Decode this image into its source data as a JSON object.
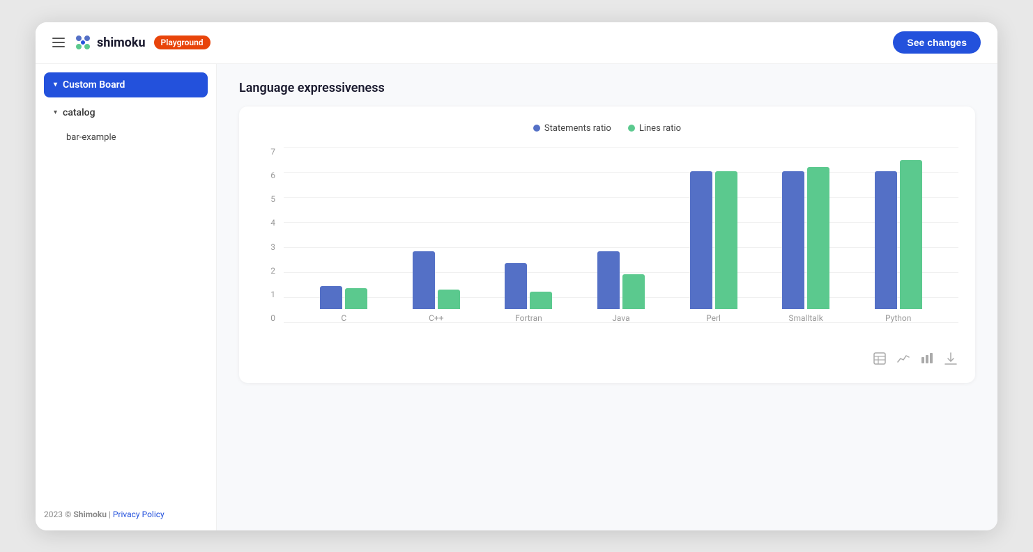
{
  "header": {
    "hamburger_label": "menu",
    "logo_text": "shimoku",
    "playground_label": "Playground",
    "see_changes_label": "See changes"
  },
  "sidebar": {
    "custom_board_label": "Custom Board",
    "catalog_label": "catalog",
    "bar_example_label": "bar-example",
    "footer_year": "2023 © ",
    "footer_brand": "Shimoku",
    "footer_separator": " | ",
    "footer_link": "Privacy Policy"
  },
  "chart": {
    "title": "Language expressiveness",
    "legend": [
      {
        "label": "Statements ratio",
        "color": "blue"
      },
      {
        "label": "Lines ratio",
        "color": "green"
      }
    ],
    "y_labels": [
      "0",
      "1",
      "2",
      "3",
      "4",
      "5",
      "6",
      "7"
    ],
    "max_value": 7,
    "data": [
      {
        "lang": "C",
        "statements": 1.0,
        "lines": 0.9
      },
      {
        "lang": "C++",
        "statements": 2.5,
        "lines": 0.85
      },
      {
        "lang": "Fortran",
        "statements": 2.0,
        "lines": 0.75
      },
      {
        "lang": "Java",
        "statements": 2.5,
        "lines": 1.5
      },
      {
        "lang": "Perl",
        "statements": 6.0,
        "lines": 6.0
      },
      {
        "lang": "Smalltalk",
        "statements": 6.0,
        "lines": 6.2
      },
      {
        "lang": "Python",
        "statements": 6.0,
        "lines": 6.5
      }
    ],
    "toolbar_icons": [
      "table",
      "line-chart",
      "bar-chart",
      "download"
    ]
  },
  "colors": {
    "accent_blue": "#2351dc",
    "bar_blue": "#5470c6",
    "bar_green": "#5bc98e",
    "playground_bg": "#e8440a"
  }
}
